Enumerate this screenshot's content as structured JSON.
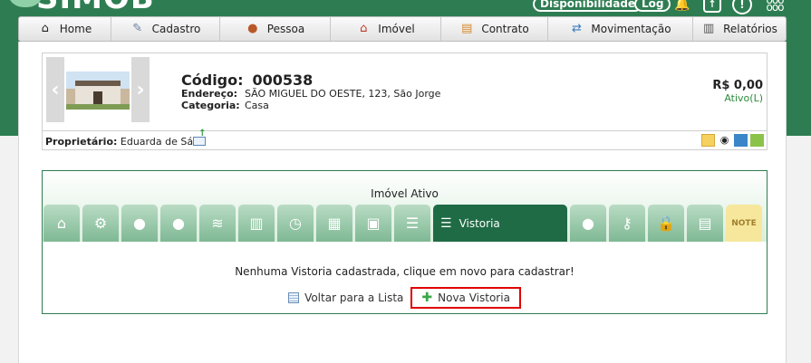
{
  "header": {
    "logo_text": "SIMOB",
    "disponibilidade": "Disponibilidade",
    "log": "Log"
  },
  "nav": [
    {
      "label": "Home",
      "icon": "home-icon"
    },
    {
      "label": "Cadastro",
      "icon": "pen-icon"
    },
    {
      "label": "Pessoa",
      "icon": "person-icon"
    },
    {
      "label": "Imóvel",
      "icon": "house-icon"
    },
    {
      "label": "Contrato",
      "icon": "contract-icon"
    },
    {
      "label": "Movimentação",
      "icon": "exchange-icon"
    },
    {
      "label": "Relatórios",
      "icon": "clipboard-icon"
    }
  ],
  "property": {
    "codigo_label": "Código:",
    "codigo": "000538",
    "endereco_label": "Endereço:",
    "endereco": "SÃO MIGUEL DO OESTE, 123, São Jorge",
    "categoria_label": "Categoria:",
    "categoria": "Casa",
    "price": "R$ 0,00",
    "status": "Ativo(L)",
    "owner_label": "Proprietário:",
    "owner": "Eduarda de Sá"
  },
  "panel": {
    "title": "Imóvel Ativo",
    "active_tab": "Vistoria",
    "note_tab": "NOTE",
    "empty_message": "Nenhuma Vistoria cadastrada, clique em novo para cadastrar!",
    "back_label": "Voltar para a Lista",
    "new_label": "Nova Vistoria"
  },
  "colors": {
    "brand_green": "#2e7d52",
    "highlight_red": "#e00000"
  }
}
